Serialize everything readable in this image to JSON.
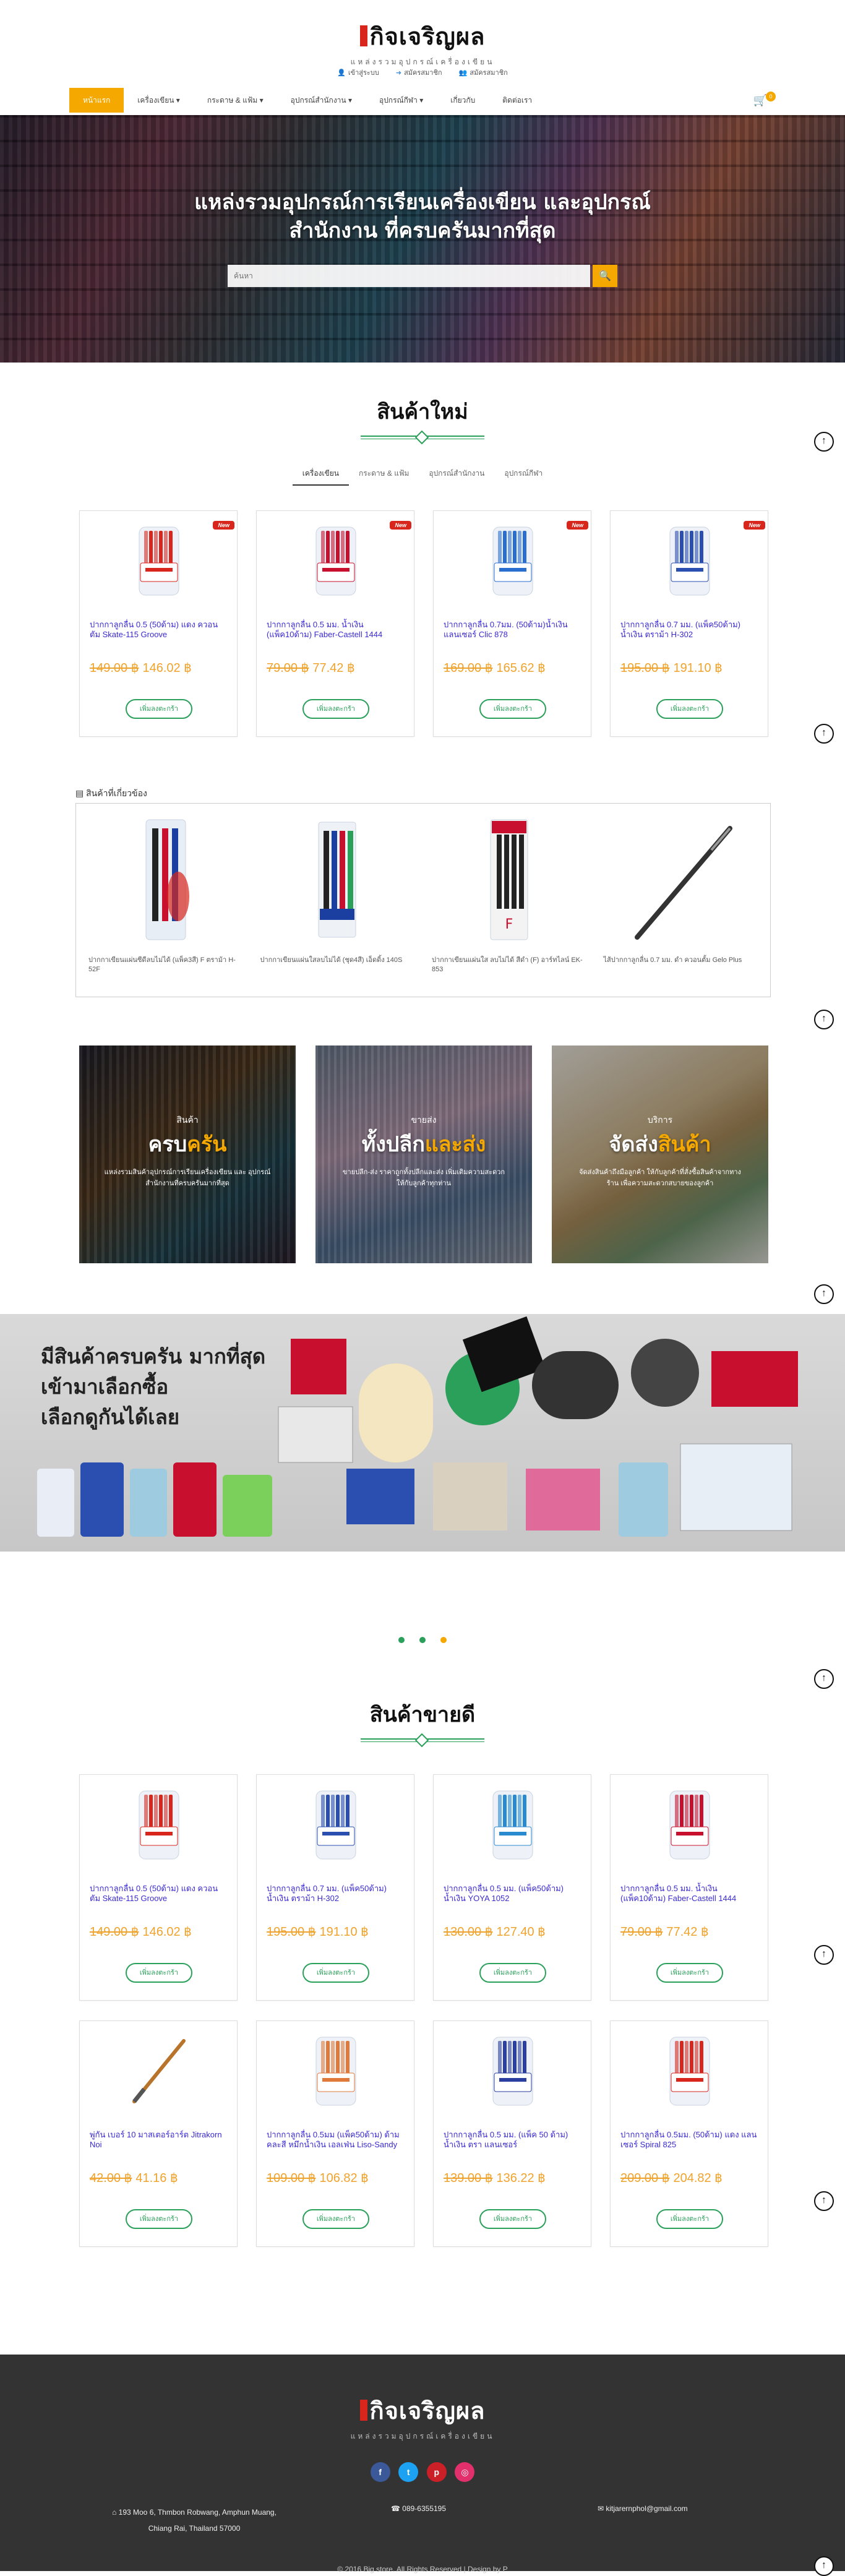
{
  "header": {
    "logo_title": "กิจเจริญผล",
    "logo_subtitle": "แหล่งรวมอุปกรณ์เครื่องเขียน",
    "top_links": [
      {
        "icon": "user-icon",
        "label": "เข้าสู่ระบบ"
      },
      {
        "icon": "sign-in-icon",
        "label": "สมัครสมาชิก"
      },
      {
        "icon": "users-icon",
        "label": "สมัครสมาชิก"
      }
    ],
    "nav": [
      {
        "label": "หน้าแรก",
        "active": true
      },
      {
        "label": "เครื่องเขียน ▾"
      },
      {
        "label": "กระดาษ & แฟ้ม ▾"
      },
      {
        "label": "อุปกรณ์สำนักงาน ▾"
      },
      {
        "label": "อุปกรณ์กีฬา ▾"
      },
      {
        "label": "เกี่ยวกับ"
      },
      {
        "label": "ติดต่อเรา"
      }
    ],
    "cart_count": "0"
  },
  "hero": {
    "title_line1": "แหล่งรวมอุปกรณ์การเรียนเครื่องเขียน และอุปกรณ์",
    "title_line2": "สำนักงาน ที่ครบครันมากที่สุด",
    "search_placeholder": "ค้นหา"
  },
  "new_products": {
    "title": "สินค้าใหม่",
    "tabs": [
      "เครื่องเขียน",
      "กระดาษ & แฟ้ม",
      "อุปกรณ์สำนักงาน",
      "อุปกรณ์กีฬา"
    ],
    "badge": "New",
    "more_label": "เพิ่มลงตะกร้า",
    "items": [
      {
        "name": "ปากกาลูกลื่น 0.5 (50ด้าม) แดง ควอนตัม Skate-115 Groove",
        "old_price": "149.00 ฿",
        "price": "146.02 ฿",
        "color": "#d9261c"
      },
      {
        "name": "ปากกาลูกลื่น 0.5 มม. น้ำเงิน (แพ็ค10ด้าม) Faber-Castell 1444",
        "old_price": "79.00 ฿",
        "price": "77.42 ฿",
        "color": "#c8102e"
      },
      {
        "name": "ปากกาลูกลื่น 0.7มม. (50ด้าม)น้ำเงิน แลนเซอร์ Clic 878",
        "old_price": "169.00 ฿",
        "price": "165.62 ฿",
        "color": "#2a6fd0"
      },
      {
        "name": "ปากกาลูกลื่น 0.7 มม. (แพ็ค50ด้าม) น้ำเงิน ตราม้า H-302",
        "old_price": "195.00 ฿",
        "price": "191.10 ฿",
        "color": "#2a4fb0"
      }
    ]
  },
  "related": {
    "heading": "สินค้าที่เกี่ยวข้อง",
    "items": [
      {
        "name": "ปากกาเขียนแผ่นซีดีลบไม่ได้ (แพ็ค3สี) F ตราม้า H-52F"
      },
      {
        "name": "ปากกาเขียนแผ่นใสลบไม่ได้ (ชุด4สี) เอ็ดดิ้ง 140S"
      },
      {
        "name": "ปากกาเขียนแผ่นใส ลบไม่ได้ สีดำ (F) อาร์ทไลน์ EK-853"
      },
      {
        "name": "ไส้ปากกาลูกลื่น 0.7 มม. ดำ ควอนตั้ม Gelo Plus"
      }
    ]
  },
  "features": [
    {
      "small": "สินค้า",
      "big_a": "ครบ",
      "big_b": "ครัน",
      "desc": "แหล่งรวมสินค้าอุปกรณ์การเรียนเครื่องเขียน และ อุปกรณ์สำนักงานที่ครบครันมากที่สุด"
    },
    {
      "small": "ขายส่ง",
      "big_a": "ทั้งปลีก",
      "big_b": "และส่ง",
      "desc": "ขายปลีก-ส่ง ราคาถูกทั้งปลีกและส่ง เพิ่มเติมความสะดวกให้กับลูกค้าทุกท่าน"
    },
    {
      "small": "บริการ",
      "big_a": "จัดส่ง",
      "big_b": "สินค้า",
      "desc": "จัดส่งสินค้าถึงมือลูกค้า ให้กับลูกค้าที่สั่งซื้อสินค้าจากทางร้าน เพื่อความสะดวกสบายของลูกค้า"
    }
  ],
  "banner": {
    "line1": "มีสินค้าครบครัน มากที่สุด",
    "line2": "เข้ามาเลือกซื้อ",
    "line3": "เลือกดูกันได้เลย"
  },
  "best_sellers": {
    "title": "สินค้าขายดี",
    "more_label": "เพิ่มลงตะกร้า",
    "items": [
      {
        "name": "ปากกาลูกลื่น 0.5 (50ด้าม) แดง ควอนตัม Skate-115 Groove",
        "old_price": "149.00 ฿",
        "price": "146.02 ฿",
        "color": "#d9261c"
      },
      {
        "name": "ปากกาลูกลื่น 0.7 มม. (แพ็ค50ด้าม) น้ำเงิน ตราม้า H-302",
        "old_price": "195.00 ฿",
        "price": "191.10 ฿",
        "color": "#2a4fb0"
      },
      {
        "name": "ปากกาลูกลื่น 0.5 มม. (แพ็ค50ด้าม) น้ำเงิน YOYA 1052",
        "old_price": "130.00 ฿",
        "price": "127.40 ฿",
        "color": "#2a8ad0"
      },
      {
        "name": "ปากกาลูกลื่น 0.5 มม. น้ำเงิน (แพ็ค10ด้าม) Faber-Castell 1444",
        "old_price": "79.00 ฿",
        "price": "77.42 ฿",
        "color": "#c8102e"
      },
      {
        "name": "พู่กัน เบอร์ 10 มาสเตอร์อาร์ต Jitrakorn Noi",
        "old_price": "42.00 ฿",
        "price": "41.16 ฿",
        "color": "#b8742a"
      },
      {
        "name": "ปากกาลูกลื่น 0.5มม (แพ็ค50ด้าม) ด้ามคละสี หมึกน้ำเงิน เอลเฟ่น Liso-Sandy",
        "old_price": "109.00 ฿",
        "price": "106.82 ฿",
        "color": "#e07a3a"
      },
      {
        "name": "ปากกาลูกลื่น 0.5 มม. (แพ็ค 50 ด้าม) น้ำเงิน ตรา แลนเซอร์",
        "old_price": "139.00 ฿",
        "price": "136.22 ฿",
        "color": "#2a3fa0"
      },
      {
        "name": "ปากกาลูกลื่น 0.5มม. (50ด้าม) แดง แลนเซอร์ Spiral 825",
        "old_price": "209.00 ฿",
        "price": "204.82 ฿",
        "color": "#d9261c"
      }
    ]
  },
  "footer": {
    "logo_title": "กิจเจริญผล",
    "logo_subtitle": "แหล่งรวมอุปกรณ์เครื่องเขียน",
    "socials": [
      "f",
      "t",
      "p",
      "◎"
    ],
    "address_line1": "193 Moo 6, Thmbon Robwang, Amphun Muang,",
    "address_line2": "Chiang Rai, Thailand 57000",
    "phone": "089-6355195",
    "email": "kitjarernphol@gmail.com",
    "copyright": "© 2016 Big store. All Rights Reserved | Design by P"
  },
  "colors": {
    "brand_green": "#2aa05a",
    "accent_orange": "#f5a800",
    "price_orange": "#f0a32c",
    "product_link": "#3a2ad0"
  }
}
